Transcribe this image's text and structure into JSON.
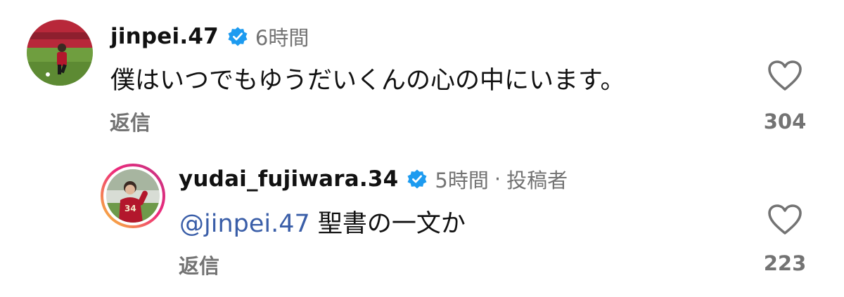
{
  "colors": {
    "verified_badge": "#1d9bf0",
    "meta_text": "#737373",
    "mention": "#3a5ea8",
    "story_ring_start": "#f9ce34",
    "story_ring_mid": "#ee2a7b",
    "story_ring_end": "#c13584"
  },
  "comments": [
    {
      "avatar": "avatar-photo",
      "username": "jinpei.47",
      "verified_icon": "verified-badge-icon",
      "time": "6時間",
      "text": "僕はいつでもゆうだいくんの心の中にいます。",
      "reply_label": "返信",
      "like_icon": "heart-outline-icon",
      "like_count": "304"
    }
  ],
  "replies": [
    {
      "avatar": "avatar-photo-story-ring",
      "username": "yudai_fujiwara.34",
      "verified_icon": "verified-badge-icon",
      "time": "5時間",
      "separator": "·",
      "author_label": "投稿者",
      "mention": "@jinpei.47",
      "text": " 聖書の一文か",
      "reply_label": "返信",
      "like_icon": "heart-outline-icon",
      "like_count": "223"
    }
  ]
}
